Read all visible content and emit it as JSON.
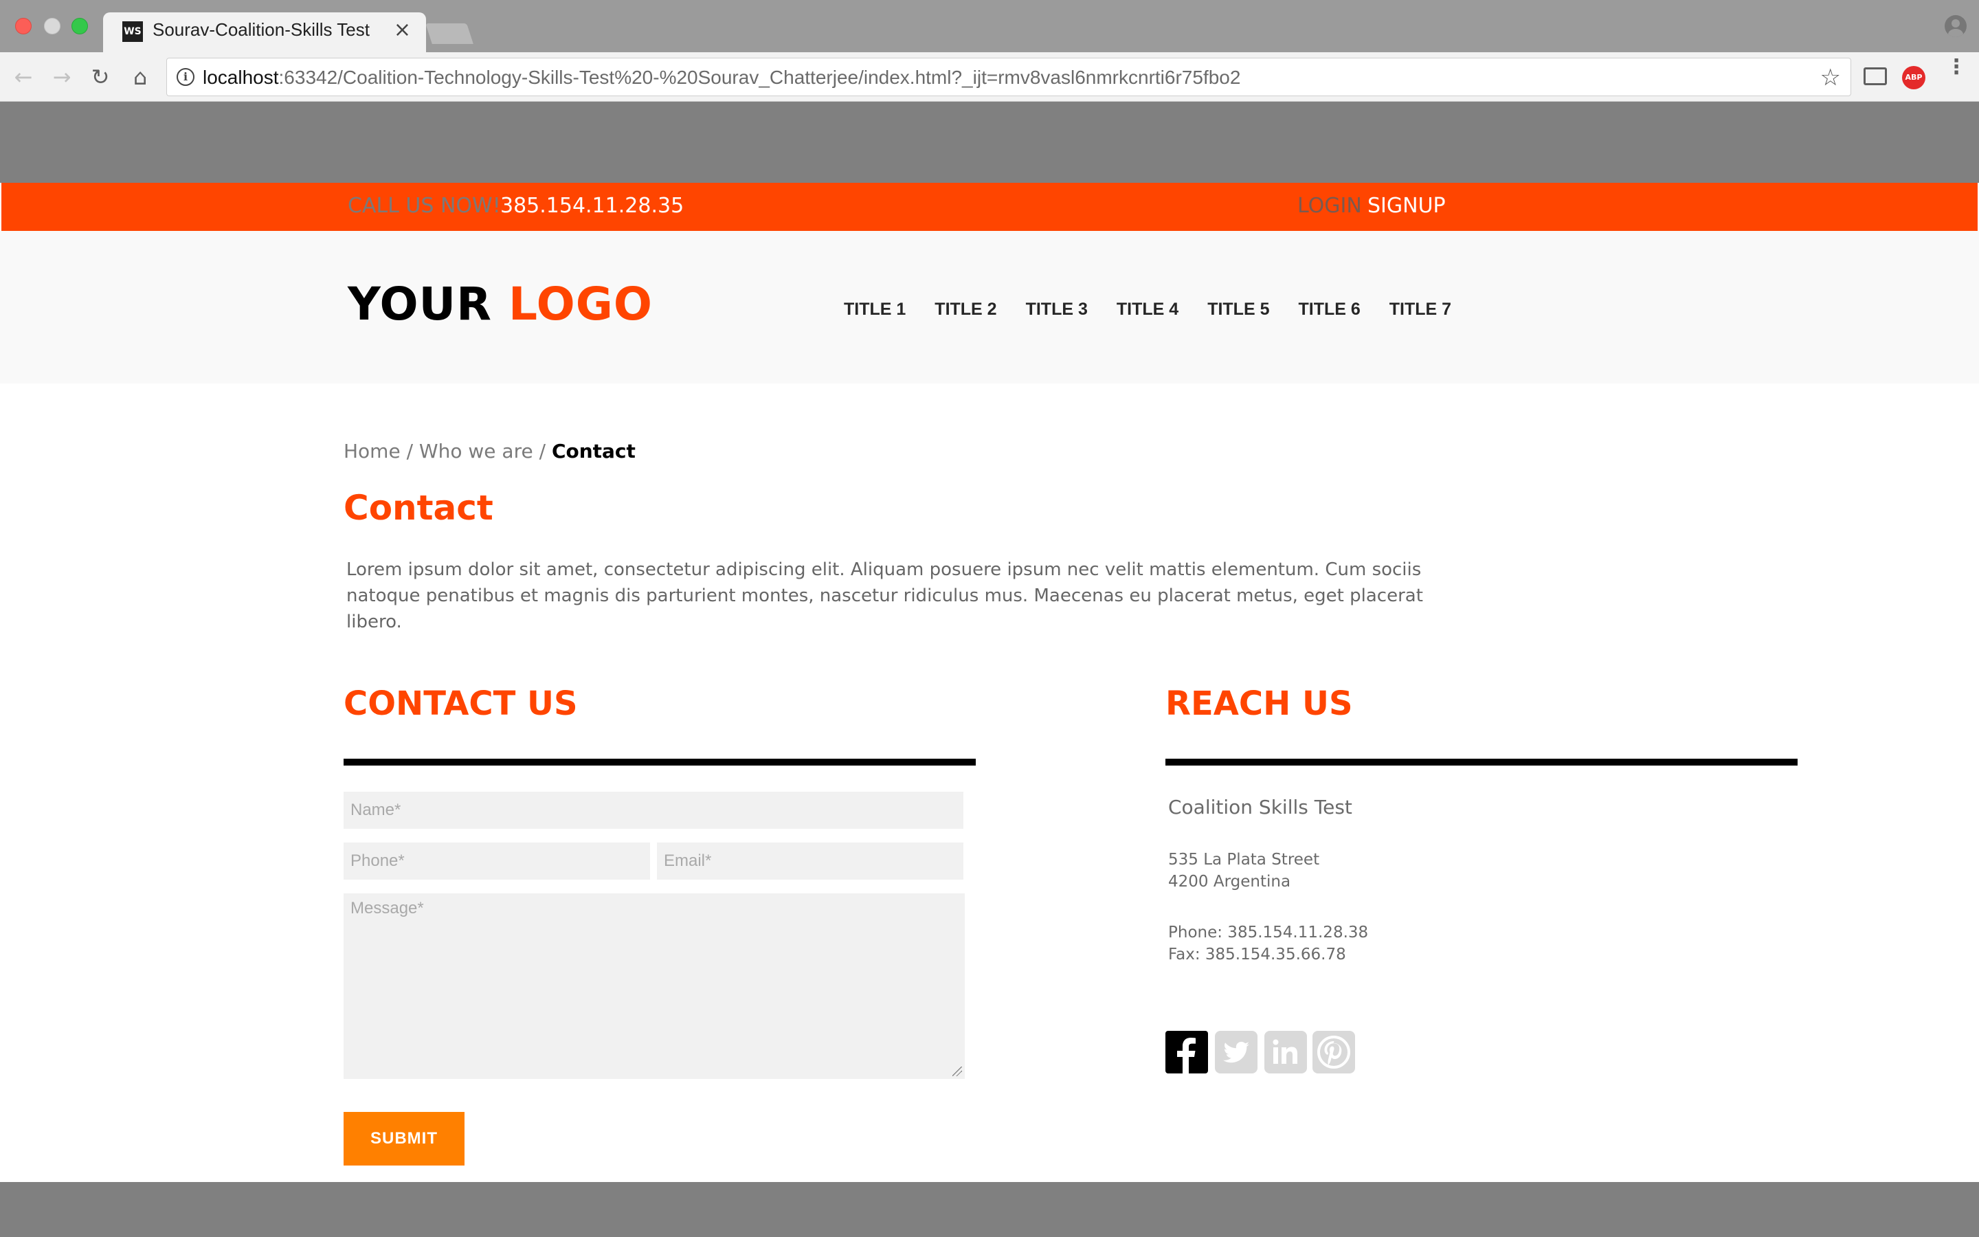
{
  "browser": {
    "tab_title": "Sourav-Coalition-Skills Test",
    "tab_favicon": "WS",
    "tab_close": "×",
    "url_host": "localhost",
    "url_rest": ":63342/Coalition-Technology-Skills-Test%20-%20Sourav_Chatterjee/index.html?_ijt=rmv8vasl6nmrkcnrti6r75fbo2",
    "back_glyph": "←",
    "forward_glyph": "→",
    "reload_glyph": "↻",
    "home_glyph": "⌂",
    "star_glyph": "☆",
    "abp_label": "ABP",
    "menu_glyph": "⋮",
    "info_glyph": "i"
  },
  "topbar": {
    "call_label": "CALL US NOW!",
    "phone": "385.154.11.28.35",
    "login": "LOGIN",
    "signup": "SIGNUP",
    "bar_color": "#ff4500"
  },
  "header": {
    "logo_part1": "YOUR",
    "logo_part2": "LOGO",
    "nav": [
      "TITLE 1",
      "TITLE 2",
      "TITLE 3",
      "TITLE 4",
      "TITLE 5",
      "TITLE 6",
      "TITLE 7"
    ]
  },
  "breadcrumb": {
    "home": "Home",
    "sep1": " / ",
    "who": "Who we are",
    "sep2": " / ",
    "current": "Contact"
  },
  "main": {
    "title": "Contact",
    "intro": "Lorem ipsum dolor sit amet, consectetur adipiscing elit. Aliquam posuere ipsum nec velit mattis elementum. Cum sociis natoque penatibus et magnis dis parturient montes, nascetur ridiculus mus. Maecenas eu placerat metus, eget placerat libero."
  },
  "contact_form": {
    "heading": "CONTACT US",
    "name_placeholder": "Name*",
    "phone_placeholder": "Phone*",
    "email_placeholder": "Email*",
    "message_placeholder": "Message*",
    "submit_label": "SUBMIT",
    "submit_color": "#ff8000"
  },
  "reach": {
    "heading": "REACH US",
    "company": "Coalition Skills Test",
    "address_line1": "535 La Plata Street",
    "address_line2": "4200 Argentina",
    "phone": "Phone: 385.154.11.28.38",
    "fax": "Fax: 385.154.35.66.78",
    "social_icons": [
      "facebook-icon",
      "twitter-icon",
      "linkedin-icon",
      "pinterest-icon"
    ]
  }
}
